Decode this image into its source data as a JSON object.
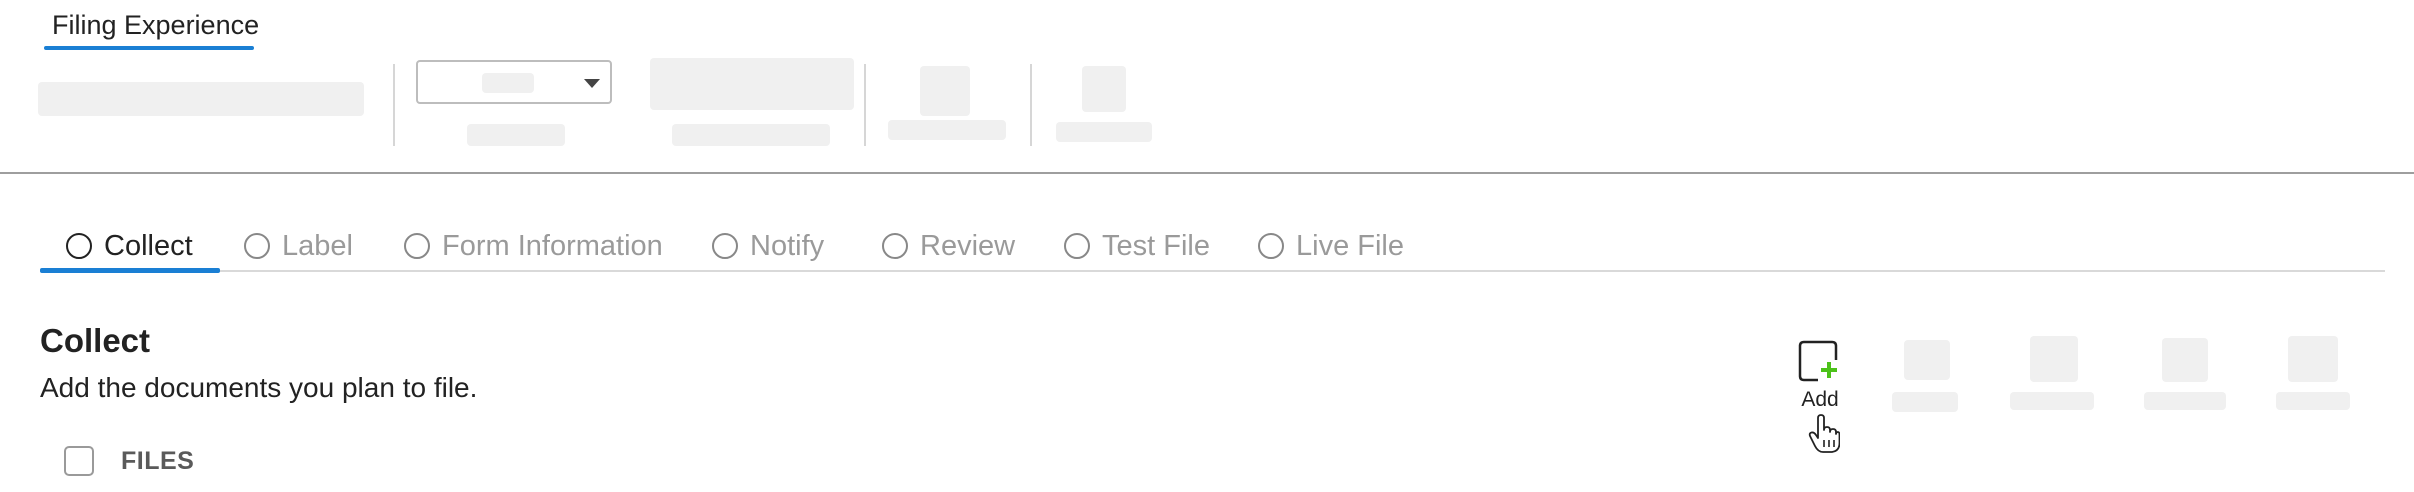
{
  "header": {
    "tab_label": "Filing Experience",
    "accent_color": "#1a7fd4"
  },
  "toolbar": {
    "dropdown": {
      "selected": ""
    }
  },
  "steps": [
    {
      "label": "Collect",
      "active": true
    },
    {
      "label": "Label",
      "active": false
    },
    {
      "label": "Form Information",
      "active": false
    },
    {
      "label": "Notify",
      "active": false
    },
    {
      "label": "Review",
      "active": false
    },
    {
      "label": "Test File",
      "active": false
    },
    {
      "label": "Live File",
      "active": false
    }
  ],
  "section": {
    "title": "Collect",
    "description": "Add the documents you plan to file."
  },
  "files": {
    "header": "FILES"
  },
  "actions": {
    "add": {
      "label": "Add",
      "icon": "add-document-icon",
      "plus_color": "#4cc21a"
    }
  }
}
